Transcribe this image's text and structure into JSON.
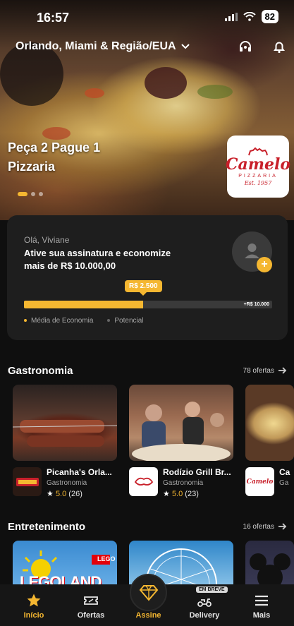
{
  "status": {
    "time": "16:57",
    "battery": "82"
  },
  "header": {
    "location": "Orlando, Miami & Região/EUA"
  },
  "hero": {
    "promo_line1": "Peça 2 Pague 1",
    "promo_line2": "Pizzaria",
    "logo": {
      "word": "Camelo",
      "sub": "PIZZARIA",
      "est": "Est. 1957"
    },
    "slide_count": 3,
    "active_slide": 1
  },
  "savings": {
    "greeting": "Olá, Viviane",
    "headline_line1": "Ative sua assinatura e economize",
    "headline_line2": "mais de  R$ 10.000,00",
    "progress_label": "R$ 2.500",
    "progress_max_label": "+R$ 10.000",
    "progress_fraction": 0.48,
    "legend": [
      "Média de Economia",
      "Potencial"
    ]
  },
  "sections": {
    "gastronomia": {
      "title": "Gastronomia",
      "count": "78 ofertas",
      "items": [
        {
          "name": "Picanha's Orla...",
          "category": "Gastronomia",
          "score": "5.0",
          "reviews": "(26)"
        },
        {
          "name": "Rodízio Grill Br...",
          "category": "Gastronomia",
          "score": "5.0",
          "reviews": "(23)"
        },
        {
          "name": "Ca",
          "category": "Ga"
        }
      ]
    },
    "entretenimento": {
      "title": "Entretenimento",
      "count": "16 ofertas",
      "legoland_text": "LEGOLAND",
      "lego_badge": "LEGO"
    }
  },
  "nav": {
    "items": [
      "Início",
      "Ofertas",
      "Assine",
      "Delivery",
      "Mais"
    ],
    "soon_badge": "EM BREVE"
  },
  "colors": {
    "accent": "#f5b731",
    "background": "#0f0f0f",
    "card": "#1e1e1e",
    "brand_red": "#c8202a"
  }
}
